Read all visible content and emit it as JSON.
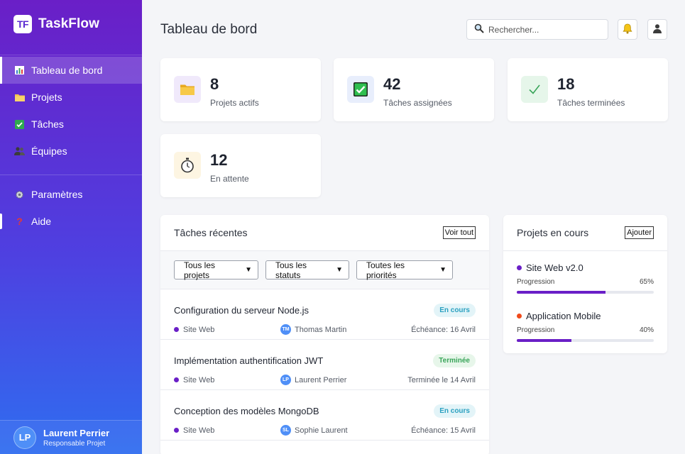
{
  "brand": {
    "logo": "TF",
    "name": "TaskFlow"
  },
  "nav": {
    "items": [
      {
        "label": "Tableau de bord",
        "icon": "chart-icon"
      },
      {
        "label": "Projets",
        "icon": "folder-icon"
      },
      {
        "label": "Tâches",
        "icon": "checkbox-icon"
      },
      {
        "label": "Équipes",
        "icon": "team-icon"
      }
    ],
    "secondary": [
      {
        "label": "Paramètres",
        "icon": "gear-icon"
      },
      {
        "label": "Aide",
        "icon": "question-icon"
      }
    ]
  },
  "user": {
    "initials": "LP",
    "name": "Laurent Perrier",
    "role": "Responsable Projet"
  },
  "header": {
    "title": "Tableau de bord",
    "search_placeholder": "Rechercher..."
  },
  "stats": [
    {
      "value": "8",
      "label": "Projets actifs",
      "icon": "folder-icon",
      "bg": "#f0e9fb"
    },
    {
      "value": "42",
      "label": "Tâches assignées",
      "icon": "checkbox-icon",
      "bg": "#e8eefc"
    },
    {
      "value": "18",
      "label": "Tâches terminées",
      "icon": "check-icon",
      "bg": "#e6f6ea"
    },
    {
      "value": "12",
      "label": "En attente",
      "icon": "stopwatch-icon",
      "bg": "#fdf5e2"
    }
  ],
  "recent": {
    "title": "Tâches récentes",
    "view_all": "Voir tout",
    "filters": [
      "Tous les projets",
      "Tous les statuts",
      "Toutes les priorités"
    ],
    "tasks": [
      {
        "title": "Configuration du serveur Node.js",
        "status": "En cours",
        "project": "Site Web",
        "assignee_initials": "TM",
        "assignee": "Thomas Martin",
        "due": "Échéance: 16 Avril"
      },
      {
        "title": "Implémentation authentification JWT",
        "status": "Terminée",
        "project": "Site Web",
        "assignee_initials": "LP",
        "assignee": "Laurent Perrier",
        "due": "Terminée le 14 Avril"
      },
      {
        "title": "Conception des modèles MongoDB",
        "status": "En cours",
        "project": "Site Web",
        "assignee_initials": "SL",
        "assignee": "Sophie Laurent",
        "due": "Échéance: 15 Avril"
      }
    ]
  },
  "projects": {
    "title": "Projets en cours",
    "add": "Ajouter",
    "progress_label": "Progression",
    "items": [
      {
        "name": "Site Web v2.0",
        "percent": "65%",
        "progress": 0.65,
        "color": "#6a1fc7"
      },
      {
        "name": "Application Mobile",
        "percent": "40%",
        "progress": 0.4,
        "color": "#f04a1a"
      }
    ]
  }
}
